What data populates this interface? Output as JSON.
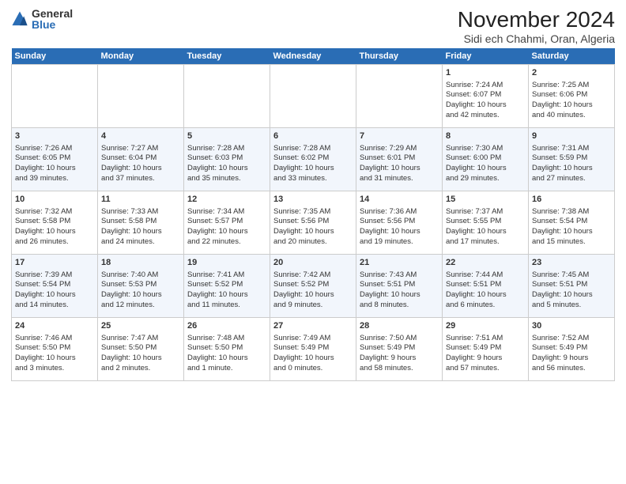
{
  "logo": {
    "general": "General",
    "blue": "Blue"
  },
  "title": "November 2024",
  "subtitle": "Sidi ech Chahmi, Oran, Algeria",
  "headers": [
    "Sunday",
    "Monday",
    "Tuesday",
    "Wednesday",
    "Thursday",
    "Friday",
    "Saturday"
  ],
  "weeks": [
    [
      {
        "day": "",
        "info": ""
      },
      {
        "day": "",
        "info": ""
      },
      {
        "day": "",
        "info": ""
      },
      {
        "day": "",
        "info": ""
      },
      {
        "day": "",
        "info": ""
      },
      {
        "day": "1",
        "info": "Sunrise: 7:24 AM\nSunset: 6:07 PM\nDaylight: 10 hours\nand 42 minutes."
      },
      {
        "day": "2",
        "info": "Sunrise: 7:25 AM\nSunset: 6:06 PM\nDaylight: 10 hours\nand 40 minutes."
      }
    ],
    [
      {
        "day": "3",
        "info": "Sunrise: 7:26 AM\nSunset: 6:05 PM\nDaylight: 10 hours\nand 39 minutes."
      },
      {
        "day": "4",
        "info": "Sunrise: 7:27 AM\nSunset: 6:04 PM\nDaylight: 10 hours\nand 37 minutes."
      },
      {
        "day": "5",
        "info": "Sunrise: 7:28 AM\nSunset: 6:03 PM\nDaylight: 10 hours\nand 35 minutes."
      },
      {
        "day": "6",
        "info": "Sunrise: 7:28 AM\nSunset: 6:02 PM\nDaylight: 10 hours\nand 33 minutes."
      },
      {
        "day": "7",
        "info": "Sunrise: 7:29 AM\nSunset: 6:01 PM\nDaylight: 10 hours\nand 31 minutes."
      },
      {
        "day": "8",
        "info": "Sunrise: 7:30 AM\nSunset: 6:00 PM\nDaylight: 10 hours\nand 29 minutes."
      },
      {
        "day": "9",
        "info": "Sunrise: 7:31 AM\nSunset: 5:59 PM\nDaylight: 10 hours\nand 27 minutes."
      }
    ],
    [
      {
        "day": "10",
        "info": "Sunrise: 7:32 AM\nSunset: 5:58 PM\nDaylight: 10 hours\nand 26 minutes."
      },
      {
        "day": "11",
        "info": "Sunrise: 7:33 AM\nSunset: 5:58 PM\nDaylight: 10 hours\nand 24 minutes."
      },
      {
        "day": "12",
        "info": "Sunrise: 7:34 AM\nSunset: 5:57 PM\nDaylight: 10 hours\nand 22 minutes."
      },
      {
        "day": "13",
        "info": "Sunrise: 7:35 AM\nSunset: 5:56 PM\nDaylight: 10 hours\nand 20 minutes."
      },
      {
        "day": "14",
        "info": "Sunrise: 7:36 AM\nSunset: 5:56 PM\nDaylight: 10 hours\nand 19 minutes."
      },
      {
        "day": "15",
        "info": "Sunrise: 7:37 AM\nSunset: 5:55 PM\nDaylight: 10 hours\nand 17 minutes."
      },
      {
        "day": "16",
        "info": "Sunrise: 7:38 AM\nSunset: 5:54 PM\nDaylight: 10 hours\nand 15 minutes."
      }
    ],
    [
      {
        "day": "17",
        "info": "Sunrise: 7:39 AM\nSunset: 5:54 PM\nDaylight: 10 hours\nand 14 minutes."
      },
      {
        "day": "18",
        "info": "Sunrise: 7:40 AM\nSunset: 5:53 PM\nDaylight: 10 hours\nand 12 minutes."
      },
      {
        "day": "19",
        "info": "Sunrise: 7:41 AM\nSunset: 5:52 PM\nDaylight: 10 hours\nand 11 minutes."
      },
      {
        "day": "20",
        "info": "Sunrise: 7:42 AM\nSunset: 5:52 PM\nDaylight: 10 hours\nand 9 minutes."
      },
      {
        "day": "21",
        "info": "Sunrise: 7:43 AM\nSunset: 5:51 PM\nDaylight: 10 hours\nand 8 minutes."
      },
      {
        "day": "22",
        "info": "Sunrise: 7:44 AM\nSunset: 5:51 PM\nDaylight: 10 hours\nand 6 minutes."
      },
      {
        "day": "23",
        "info": "Sunrise: 7:45 AM\nSunset: 5:51 PM\nDaylight: 10 hours\nand 5 minutes."
      }
    ],
    [
      {
        "day": "24",
        "info": "Sunrise: 7:46 AM\nSunset: 5:50 PM\nDaylight: 10 hours\nand 3 minutes."
      },
      {
        "day": "25",
        "info": "Sunrise: 7:47 AM\nSunset: 5:50 PM\nDaylight: 10 hours\nand 2 minutes."
      },
      {
        "day": "26",
        "info": "Sunrise: 7:48 AM\nSunset: 5:50 PM\nDaylight: 10 hours\nand 1 minute."
      },
      {
        "day": "27",
        "info": "Sunrise: 7:49 AM\nSunset: 5:49 PM\nDaylight: 10 hours\nand 0 minutes."
      },
      {
        "day": "28",
        "info": "Sunrise: 7:50 AM\nSunset: 5:49 PM\nDaylight: 9 hours\nand 58 minutes."
      },
      {
        "day": "29",
        "info": "Sunrise: 7:51 AM\nSunset: 5:49 PM\nDaylight: 9 hours\nand 57 minutes."
      },
      {
        "day": "30",
        "info": "Sunrise: 7:52 AM\nSunset: 5:49 PM\nDaylight: 9 hours\nand 56 minutes."
      }
    ]
  ]
}
